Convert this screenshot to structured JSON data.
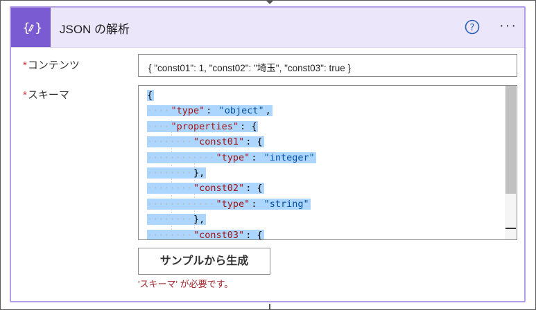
{
  "card": {
    "title": "JSON の解析",
    "help_label": "?",
    "more_label": "···"
  },
  "fields": {
    "content": {
      "required_mark": "*",
      "label": "コンテンツ",
      "value": "{ \"const01\": 1, \"const02\": \"埼玉\", \"const03\": true  }"
    },
    "schema": {
      "required_mark": "*",
      "label": "スキーマ",
      "lines": [
        {
          "ws": "",
          "parts": [
            {
              "t": "{",
              "c": "pun"
            }
          ]
        },
        {
          "ws": "····",
          "parts": [
            {
              "t": "\"type\"",
              "c": "key"
            },
            {
              "t": ": ",
              "c": "pun"
            },
            {
              "t": "\"object\"",
              "c": "str"
            },
            {
              "t": ",",
              "c": "pun"
            }
          ]
        },
        {
          "ws": "····",
          "parts": [
            {
              "t": "\"properties\"",
              "c": "key"
            },
            {
              "t": ": {",
              "c": "pun"
            }
          ]
        },
        {
          "ws": "········",
          "parts": [
            {
              "t": "\"const01\"",
              "c": "key"
            },
            {
              "t": ": {",
              "c": "pun"
            }
          ]
        },
        {
          "ws": "············",
          "parts": [
            {
              "t": "\"type\"",
              "c": "key"
            },
            {
              "t": ": ",
              "c": "pun"
            },
            {
              "t": "\"integer\"",
              "c": "str"
            }
          ]
        },
        {
          "ws": "········",
          "parts": [
            {
              "t": "},",
              "c": "pun"
            }
          ]
        },
        {
          "ws": "········",
          "parts": [
            {
              "t": "\"const02\"",
              "c": "key"
            },
            {
              "t": ": {",
              "c": "pun"
            }
          ]
        },
        {
          "ws": "············",
          "parts": [
            {
              "t": "\"type\"",
              "c": "key"
            },
            {
              "t": ": ",
              "c": "pun"
            },
            {
              "t": "\"string\"",
              "c": "str"
            }
          ]
        },
        {
          "ws": "········",
          "parts": [
            {
              "t": "},",
              "c": "pun"
            }
          ]
        },
        {
          "ws": "········",
          "parts": [
            {
              "t": "\"const03\"",
              "c": "key"
            },
            {
              "t": ": {",
              "c": "pun"
            }
          ]
        }
      ]
    }
  },
  "buttons": {
    "generate_from_sample": "サンプルから生成"
  },
  "validation": {
    "error": "'スキーマ' が必要です。"
  },
  "colors": {
    "accent": "#7a5bd1",
    "header_bg": "#ece6fb",
    "selection": "#add6ff",
    "error": "#a4262c",
    "required": "#d13438"
  },
  "icons": {
    "action": "json-parse-icon",
    "help": "help-circle-icon",
    "more": "more-dots-icon"
  }
}
